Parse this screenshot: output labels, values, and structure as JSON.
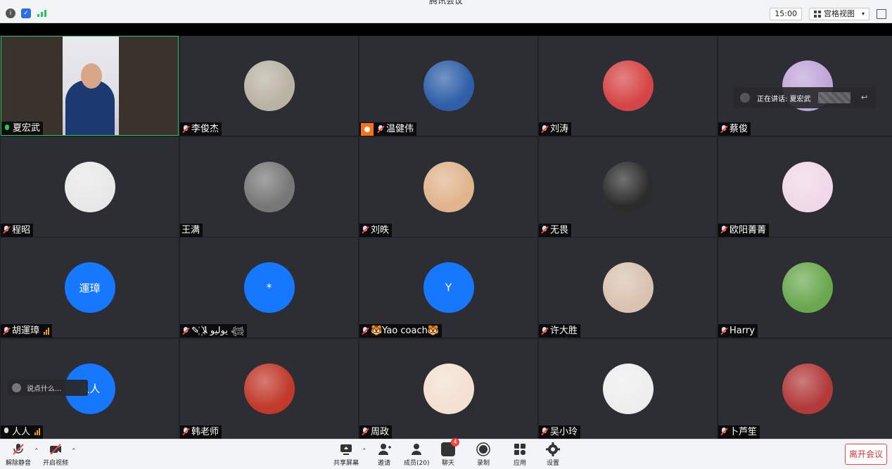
{
  "window": {
    "title": "腾讯会议"
  },
  "topbar": {
    "time": "15:00",
    "view_label": "宫格视图",
    "icons": [
      "info-icon",
      "security-shield-icon",
      "network-signal-icon",
      "fullscreen-icon"
    ]
  },
  "participants": [
    {
      "name": "夏宏武",
      "mic": "on",
      "kind": "video",
      "active": true
    },
    {
      "name": "李俊杰",
      "mic": "muted",
      "kind": "photo"
    },
    {
      "name": "温健伟",
      "mic": "muted",
      "kind": "photo",
      "host": true
    },
    {
      "name": "刘涛",
      "mic": "muted",
      "kind": "photo"
    },
    {
      "name": "蔡俊",
      "mic": "muted",
      "kind": "photo"
    },
    {
      "name": "程昭",
      "mic": "muted",
      "kind": "photo"
    },
    {
      "name": "王满",
      "mic": "none",
      "kind": "photo"
    },
    {
      "name": "刘昳",
      "mic": "muted",
      "kind": "photo"
    },
    {
      "name": "无畏",
      "mic": "muted",
      "kind": "photo"
    },
    {
      "name": "欧阳菁菁",
      "mic": "muted",
      "kind": "photo"
    },
    {
      "name": "胡運璋",
      "mic": "muted",
      "kind": "text",
      "avatar_text": "運璋",
      "signal": true
    },
    {
      "name": "✎ يوليو ﻼ꙰ 𓆉",
      "mic": "muted",
      "kind": "text",
      "avatar_text": "*"
    },
    {
      "name": "🐯Yao coach🐯",
      "mic": "muted",
      "kind": "text",
      "avatar_text": "Y"
    },
    {
      "name": "许大胜",
      "mic": "muted",
      "kind": "photo"
    },
    {
      "name": "Harry",
      "mic": "muted",
      "kind": "photo"
    },
    {
      "name": "人人",
      "mic": "on-grey",
      "kind": "text",
      "avatar_text": "人人",
      "signal": true
    },
    {
      "name": "韩老师",
      "mic": "muted",
      "kind": "photo"
    },
    {
      "name": "周政",
      "mic": "muted",
      "kind": "photo"
    },
    {
      "name": "吴小玲",
      "mic": "muted",
      "kind": "photo"
    },
    {
      "name": "卜芦笙",
      "mic": "muted",
      "kind": "photo"
    }
  ],
  "speaking_popup": {
    "label": "正在讲话: 夏宏武"
  },
  "chat_popup": {
    "placeholder": "说点什么..."
  },
  "toolbar": {
    "unmute": "解除静音",
    "start_video": "开启视频",
    "share": "共享屏幕",
    "invite": "邀请",
    "members": "成员(20)",
    "chat": "聊天",
    "chat_badge": "4",
    "record": "录制",
    "apps": "应用",
    "settings": "设置",
    "leave": "离开会议"
  },
  "colors": {
    "accent": "#1677ff",
    "active_border": "#22c55e",
    "leave": "#e34b4b"
  }
}
